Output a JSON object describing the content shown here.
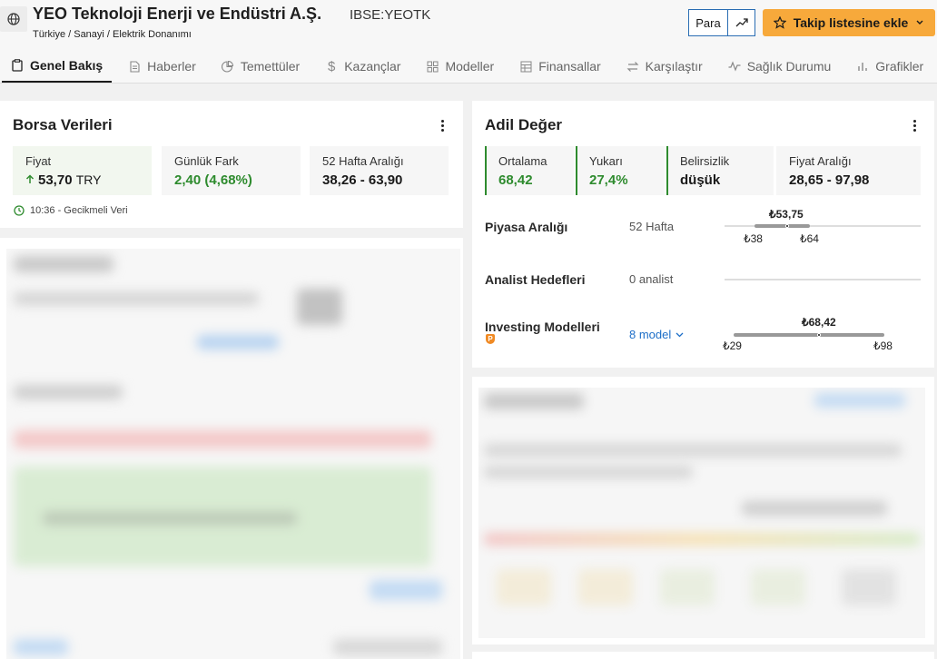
{
  "header": {
    "title": "YEO Teknoloji Enerji ve Endüstri A.Ş.",
    "ticker": "IBSE:YEOTK",
    "breadcrumb": "Türkiye / Sanayi / Elektrik Donanımı",
    "para_label": "Para",
    "watchlist_label": "Takip listesine ekle"
  },
  "tabs": [
    {
      "label": "Genel Bakış",
      "icon": "clipboard-icon"
    },
    {
      "label": "Haberler",
      "icon": "document-icon"
    },
    {
      "label": "Temettüler",
      "icon": "pie-icon"
    },
    {
      "label": "Kazançlar",
      "icon": "dollar-icon"
    },
    {
      "label": "Modeller",
      "icon": "grid-icon"
    },
    {
      "label": "Finansallar",
      "icon": "table-icon"
    },
    {
      "label": "Karşılaştır",
      "icon": "swap-icon"
    },
    {
      "label": "Sağlık Durumu",
      "icon": "pulse-icon"
    },
    {
      "label": "Grafikler",
      "icon": "bars-icon"
    }
  ],
  "borsa": {
    "title": "Borsa Verileri",
    "price_label": "Fiyat",
    "price_value": "53,70",
    "price_currency": "TRY",
    "change_label": "Günlük Fark",
    "change_value": "2,40 (4,68%)",
    "range_label": "52 Hafta Aralığı",
    "range_value": "38,26 - 63,90",
    "delay_note": "10:36 - Gecikmeli Veri"
  },
  "fair_value": {
    "title": "Adil Değer",
    "avg_label": "Ortalama",
    "avg_value": "68,42",
    "upside_label": "Yukarı",
    "upside_value": "27,4%",
    "uncert_label": "Belirsizlik",
    "uncert_value": "düşük",
    "prange_label": "Fiyat Aralığı",
    "prange_value": "28,65 - 97,98",
    "market_label": "Piyasa Aralığı",
    "market_sub": "52 Hafta",
    "market_current": "₺53,75",
    "market_low": "₺38",
    "market_high": "₺64",
    "analyst_label": "Analist Hedefleri",
    "analyst_sub": "0 analist",
    "models_label": "Investing Modelleri",
    "models_sub": "8 model",
    "models_current": "₺68,42",
    "models_low": "₺29",
    "models_high": "₺98"
  },
  "colors": {
    "accent": "#f7a93b",
    "positive": "#2e8b2e",
    "link": "#1e6fc8"
  }
}
